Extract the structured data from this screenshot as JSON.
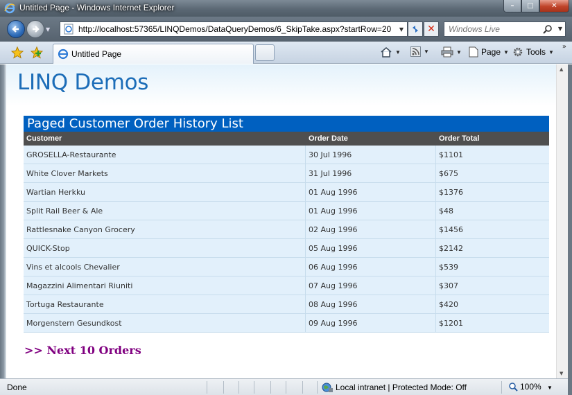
{
  "window": {
    "title": "Untitled Page - Windows Internet Explorer"
  },
  "navigation": {
    "url": "http://localhost:57365/LINQDemos/DataQueryDemos/6_SkipTake.aspx?startRow=20",
    "search_placeholder": "Windows Live"
  },
  "tabs": [
    {
      "label": "Untitled Page"
    }
  ],
  "commands": {
    "page_label": "Page",
    "tools_label": "Tools"
  },
  "page": {
    "site_title": "LINQ Demos",
    "grid": {
      "caption": "Paged Customer Order History List",
      "columns": [
        "Customer",
        "Order Date",
        "Order Total"
      ],
      "rows": [
        [
          "GROSELLA-Restaurante",
          "30 Jul 1996",
          "$1101"
        ],
        [
          "White Clover Markets",
          "31 Jul 1996",
          "$675"
        ],
        [
          "Wartian Herkku",
          "01 Aug 1996",
          "$1376"
        ],
        [
          "Split Rail Beer & Ale",
          "01 Aug 1996",
          "$48"
        ],
        [
          "Rattlesnake Canyon Grocery",
          "02 Aug 1996",
          "$1456"
        ],
        [
          "QUICK-Stop",
          "05 Aug 1996",
          "$2142"
        ],
        [
          "Vins et alcools Chevalier",
          "06 Aug 1996",
          "$539"
        ],
        [
          "Magazzini Alimentari Riuniti",
          "07 Aug 1996",
          "$307"
        ],
        [
          "Tortuga Restaurante",
          "08 Aug 1996",
          "$420"
        ],
        [
          "Morgenstern Gesundkost",
          "09 Aug 1996",
          "$1201"
        ]
      ]
    },
    "next_link": ">> Next 10 Orders"
  },
  "status": {
    "text": "Done",
    "zone": "Local intranet | Protected Mode: Off",
    "zoom": "100%"
  },
  "colors": {
    "site_title": "#1c6db8",
    "grid_caption_bg": "#0060c0",
    "grid_header_bg": "#4f4f4f",
    "grid_row_bg": "#e2f0fb",
    "next_link": "#800080"
  }
}
